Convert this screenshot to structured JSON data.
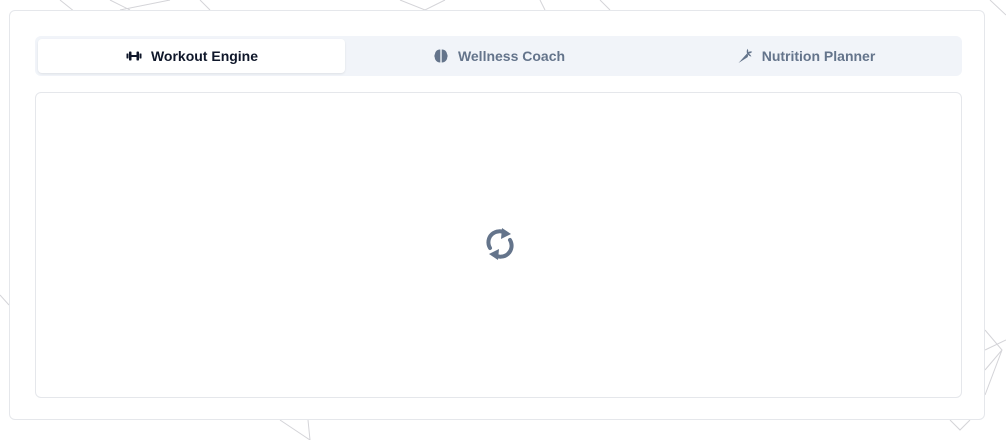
{
  "tabs": [
    {
      "label": "Workout Engine",
      "icon": "dumbbell-icon",
      "active": true
    },
    {
      "label": "Wellness Coach",
      "icon": "brain-icon",
      "active": false
    },
    {
      "label": "Nutrition Planner",
      "icon": "carrot-icon",
      "active": false
    }
  ],
  "content": {
    "state": "loading",
    "icon": "refresh-icon"
  },
  "colors": {
    "active_text": "#0f172a",
    "inactive_text": "#64748b",
    "tab_bar_bg": "#f1f4f9",
    "spinner": "#64748b",
    "border": "#e5e7eb"
  }
}
